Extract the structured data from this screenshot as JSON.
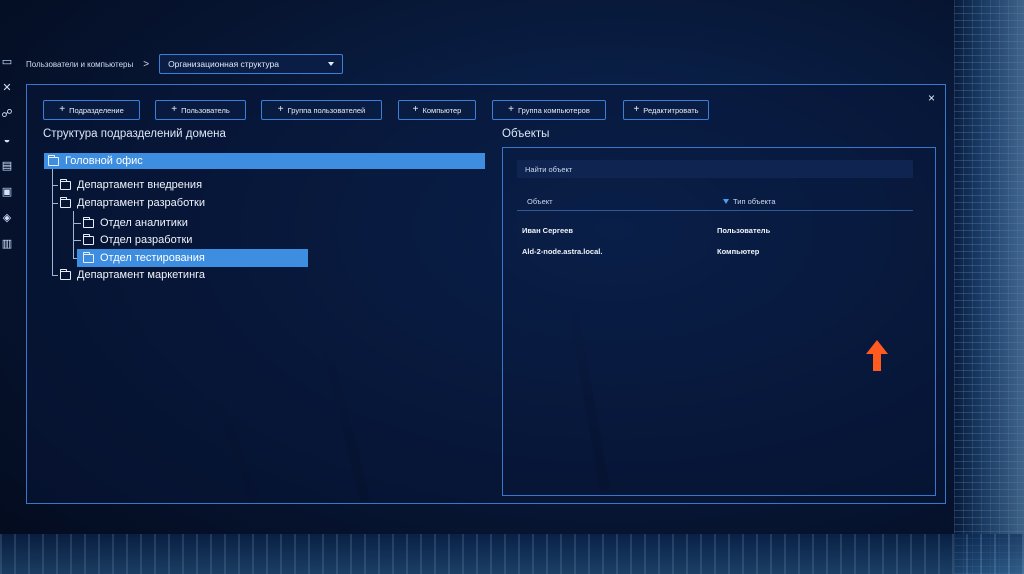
{
  "breadcrumb": {
    "section": "Пользователи и компьютеры",
    "separator": ">",
    "selected_view": "Организационная структура"
  },
  "rail_icons": [
    "monitor-icon",
    "tools-icon",
    "users-icon",
    "shield-icon",
    "card-icon",
    "screen-icon",
    "layers-icon",
    "chart-icon"
  ],
  "toolbar": {
    "subdivision": "Подразделение",
    "user": "Пользователь",
    "user_group": "Группа пользователей",
    "computer": "Компьютер",
    "computer_group": "Группа компьютеров",
    "edit": "Редактитровать"
  },
  "close_label": "×",
  "tree": {
    "title": "Структура подразделений домена",
    "root": "Головной офис",
    "dept_implementation": "Департамент внедрения",
    "dept_development": "Департамент разработки",
    "dept_analytics": "Отдел аналитики",
    "dept_dev_section": "Отдел разработки",
    "dept_testing": "Отдел тестирования",
    "dept_marketing": "Департамент маркетинга"
  },
  "objects": {
    "title": "Объекты",
    "search_placeholder": "Найти объект",
    "columns": {
      "object": "Объект",
      "type": "Тип объекта"
    },
    "rows": [
      {
        "object": "Иван Сергеев",
        "type": "Пользователь"
      },
      {
        "object": "Ald-2-node.astra.local.",
        "type": "Компьютер"
      }
    ]
  },
  "colors": {
    "accent": "#3b7fd8",
    "selection": "#3d8de0",
    "cursor": "#ff5a1f"
  }
}
